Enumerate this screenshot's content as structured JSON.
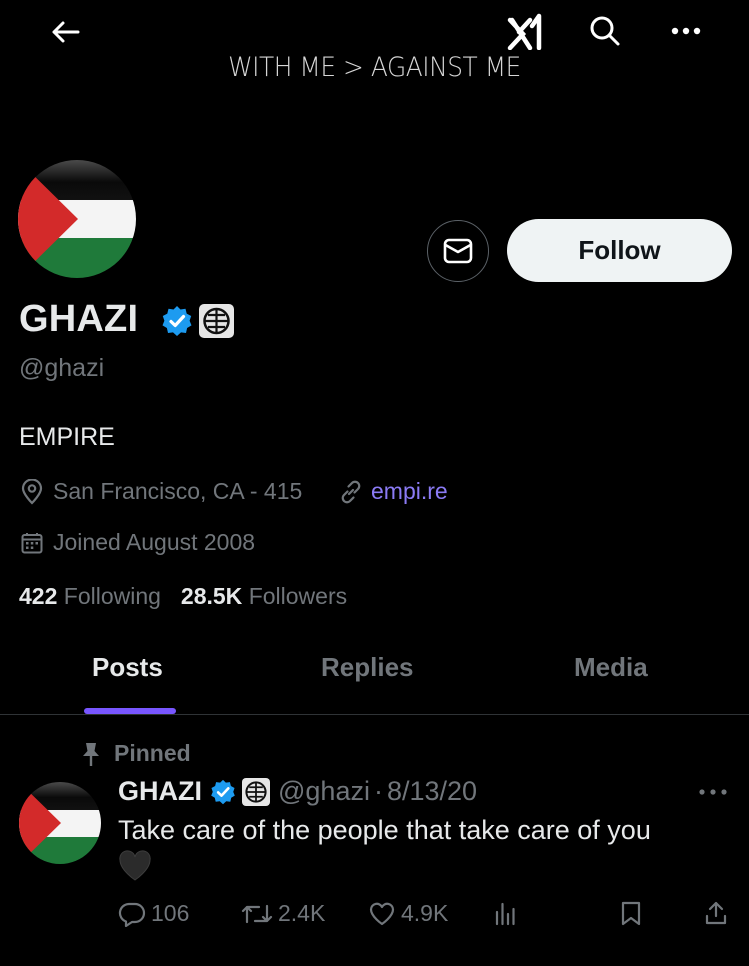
{
  "banner": {
    "text": "WITH ME > AGAINST ME"
  },
  "profile": {
    "name": "GHAZI",
    "handle": "@ghazi",
    "bio": "EMPIRE",
    "location": "San Francisco, CA - 415",
    "website": "empi.re",
    "joined": "Joined August 2008",
    "following_count": "422",
    "following_label": "Following",
    "followers_count": "28.5K",
    "followers_label": "Followers"
  },
  "actions": {
    "follow_label": "Follow"
  },
  "tabs": [
    {
      "label": "Posts",
      "active": true
    },
    {
      "label": "Replies",
      "active": false
    },
    {
      "label": "Media",
      "active": false
    }
  ],
  "tweet": {
    "pinned_label": "Pinned",
    "name": "GHAZI",
    "handle": "@ghazi",
    "separator": "·",
    "date": "8/13/20",
    "text": "Take care of the people that take care of you",
    "replies": "106",
    "reposts": "2.4K",
    "likes": "4.9K"
  },
  "colors": {
    "background": "#000000",
    "accent_tab": "#7856ff",
    "link": "#8b7bf5",
    "verified": "#1d9bf0",
    "flag_red": "#d32a2a",
    "flag_green": "#1f7a3a"
  },
  "icons": [
    "back-arrow-icon",
    "x-logo-icon",
    "search-icon",
    "more-icon",
    "mail-icon",
    "verified-badge-icon",
    "affiliate-badge-icon",
    "location-icon",
    "link-icon",
    "calendar-icon",
    "pin-icon",
    "reply-icon",
    "repost-icon",
    "like-icon",
    "views-icon",
    "bookmark-icon",
    "share-icon",
    "black-heart-emoji-icon"
  ]
}
